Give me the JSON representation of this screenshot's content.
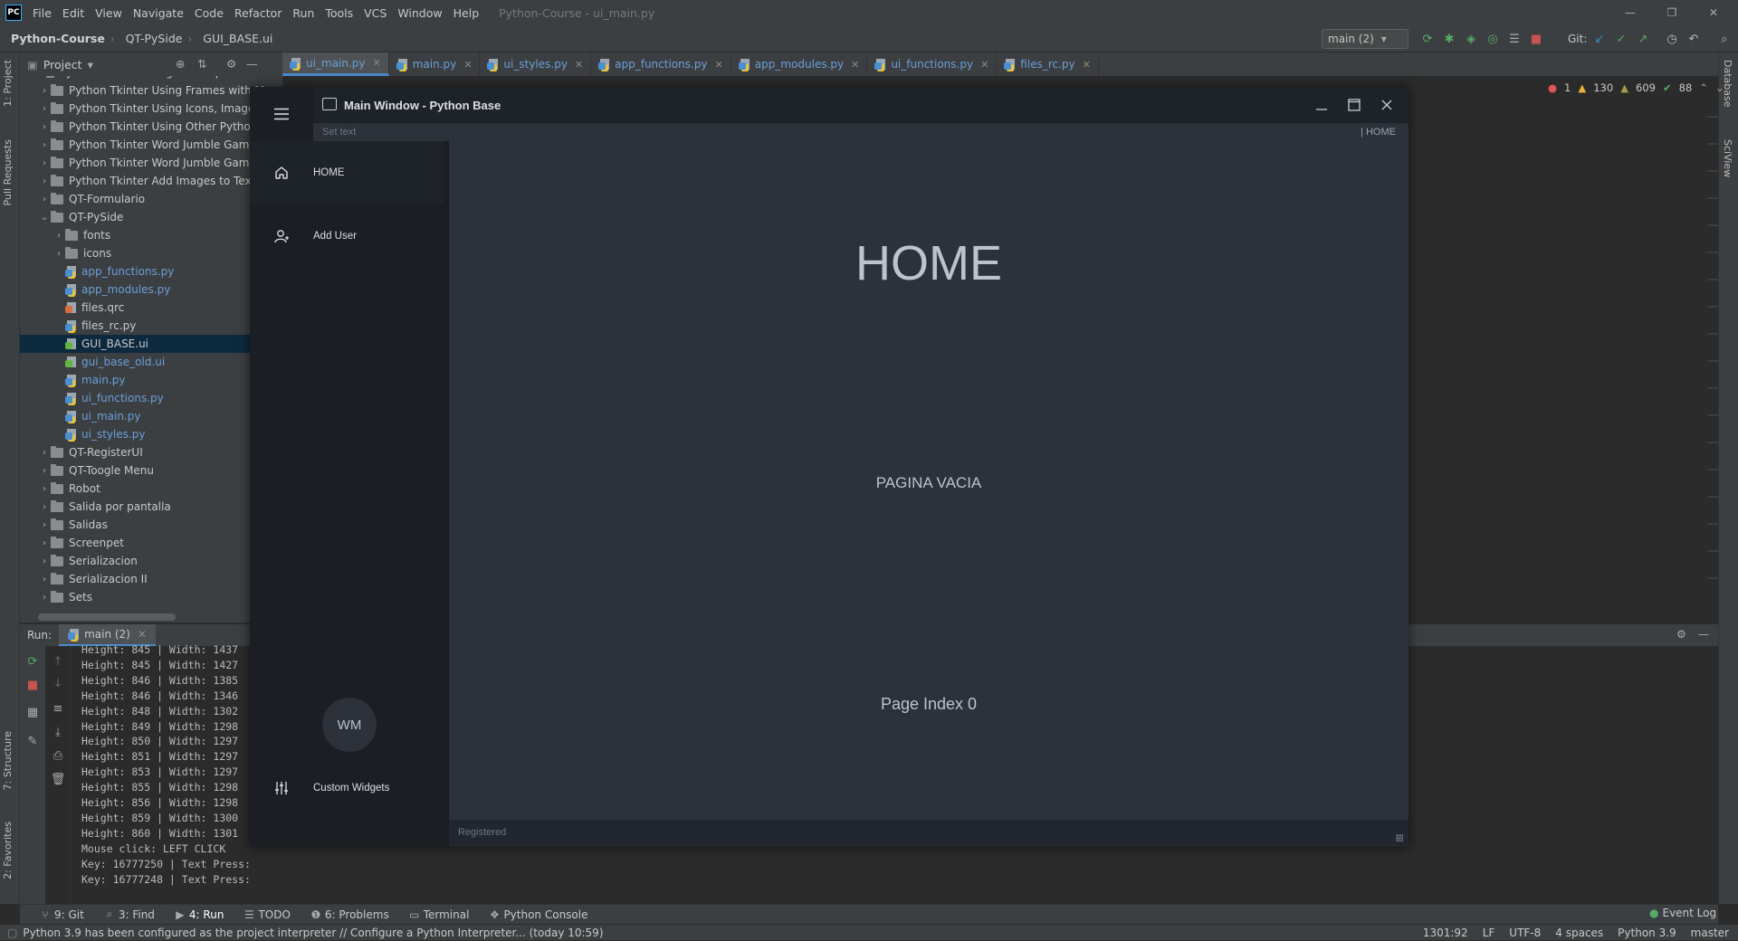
{
  "ide": {
    "logo": "PC",
    "menu": [
      "File",
      "Edit",
      "View",
      "Navigate",
      "Code",
      "Refactor",
      "Run",
      "Tools",
      "VCS",
      "Window",
      "Help"
    ],
    "title": "Python-Course - ui_main.py",
    "breadcrumb": [
      "Python-Course",
      "QT-PySide",
      "GUI_BASE.ui"
    ],
    "run_config": "main (2)",
    "git_label": "Git:",
    "project_label": "Project",
    "tabs": [
      "ui_main.py",
      "main.py",
      "ui_styles.py",
      "app_functions.py",
      "app_modules.py",
      "ui_functions.py",
      "files_rc.py"
    ],
    "active_tab": "ui_main.py",
    "inspections": {
      "errors": "1",
      "warnings": "130",
      "weak": "609",
      "ok": "88"
    },
    "left_tool_tabs": [
      "1: Project",
      "Pull Requests",
      "7: Structure",
      "2: Favorites"
    ],
    "right_tool_tabs": [
      "Database",
      "SciView"
    ],
    "tree": [
      {
        "label": "Python Tkinter Using Excel Spreadsheets",
        "type": "folder",
        "depth": 1
      },
      {
        "label": "Python Tkinter Using Frames with M",
        "type": "folder",
        "depth": 1
      },
      {
        "label": "Python Tkinter Using Icons, Image",
        "type": "folder",
        "depth": 1
      },
      {
        "label": "Python Tkinter Using Other Python F",
        "type": "folder",
        "depth": 1
      },
      {
        "label": "Python Tkinter Word Jumble Game",
        "type": "folder",
        "depth": 1
      },
      {
        "label": "Python Tkinter Word Jumble Game II",
        "type": "folder",
        "depth": 1
      },
      {
        "label": "Python Tkinter  Add Images to Text E",
        "type": "folder",
        "depth": 1
      },
      {
        "label": "QT-Formulario",
        "type": "folder",
        "depth": 1
      },
      {
        "label": "QT-PySide",
        "type": "folder-open",
        "depth": 1
      },
      {
        "label": "fonts",
        "type": "folder",
        "depth": 2
      },
      {
        "label": "icons",
        "type": "folder",
        "depth": 2
      },
      {
        "label": "app_functions.py",
        "type": "py",
        "depth": 2,
        "color": "blue"
      },
      {
        "label": "app_modules.py",
        "type": "py",
        "depth": 2,
        "color": "blue"
      },
      {
        "label": "files.qrc",
        "type": "qrc",
        "depth": 2
      },
      {
        "label": "files_rc.py",
        "type": "py",
        "depth": 2
      },
      {
        "label": "GUI_BASE.ui",
        "type": "ui",
        "depth": 2,
        "selected": true
      },
      {
        "label": "gui_base_old.ui",
        "type": "ui",
        "depth": 2,
        "color": "blue"
      },
      {
        "label": "main.py",
        "type": "py",
        "depth": 2,
        "color": "blue"
      },
      {
        "label": "ui_functions.py",
        "type": "py",
        "depth": 2,
        "color": "blue"
      },
      {
        "label": "ui_main.py",
        "type": "py",
        "depth": 2,
        "color": "blue"
      },
      {
        "label": "ui_styles.py",
        "type": "py",
        "depth": 2,
        "color": "blue"
      },
      {
        "label": "QT-RegisterUI",
        "type": "folder",
        "depth": 1
      },
      {
        "label": "QT-Toogle Menu",
        "type": "folder",
        "depth": 1
      },
      {
        "label": "Robot",
        "type": "folder",
        "depth": 1
      },
      {
        "label": "Salida por pantalla",
        "type": "folder",
        "depth": 1
      },
      {
        "label": "Salidas",
        "type": "folder",
        "depth": 1
      },
      {
        "label": "Screenpet",
        "type": "folder",
        "depth": 1
      },
      {
        "label": "Serializacion",
        "type": "folder",
        "depth": 1
      },
      {
        "label": "Serializacion II",
        "type": "folder",
        "depth": 1
      },
      {
        "label": "Sets",
        "type": "folder",
        "depth": 1
      }
    ],
    "run": {
      "label": "Run:",
      "tab": "main (2)",
      "console": [
        "Height: 845 | Width: 1437",
        "Height: 845 | Width: 1427",
        "Height: 846 | Width: 1385",
        "Height: 846 | Width: 1346",
        "Height: 848 | Width: 1302",
        "Height: 849 | Width: 1298",
        "Height: 850 | Width: 1297",
        "Height: 851 | Width: 1297",
        "Height: 853 | Width: 1297",
        "Height: 855 | Width: 1298",
        "Height: 856 | Width: 1298",
        "Height: 859 | Width: 1300",
        "Height: 860 | Width: 1301",
        "Mouse click: LEFT CLICK",
        "Key: 16777250 | Text Press:",
        "Key: 16777248 | Text Press:"
      ]
    },
    "bottom_tools": [
      {
        "label": "9: Git",
        "icon": "git-icon"
      },
      {
        "label": "3: Find",
        "icon": "search-icon"
      },
      {
        "label": "4: Run",
        "icon": "run-icon",
        "active": true
      },
      {
        "label": "TODO",
        "icon": "list-icon"
      },
      {
        "label": "6: Problems",
        "icon": "problems-icon"
      },
      {
        "label": "Terminal",
        "icon": "terminal-icon"
      },
      {
        "label": "Python Console",
        "icon": "python-icon"
      }
    ],
    "event_log": "Event Log",
    "status_message": "Python 3.9 has been configured as the project interpreter // Configure a Python Interpreter... (today 10:59)",
    "status_right": [
      "1301:92",
      "LF",
      "UTF-8",
      "4 spaces",
      "Python 3.9",
      "master"
    ]
  },
  "app": {
    "title": "Main Window - Python Base",
    "set_text": "Set text",
    "page_label": "| HOME",
    "menu": [
      {
        "label": "HOME",
        "icon": "home-icon",
        "active": true
      },
      {
        "label": "Add User",
        "icon": "add-user-icon",
        "active": false
      }
    ],
    "avatar": "WM",
    "custom_widgets": "Custom Widgets",
    "heading": "HOME",
    "empty_text": "PAGINA VACIA",
    "page_index": "Page Index 0",
    "footer": "Registered"
  },
  "colors": {
    "accent": "#4a88c7",
    "app_bg": "#2c313a",
    "app_sidebar": "#1b1e23"
  }
}
